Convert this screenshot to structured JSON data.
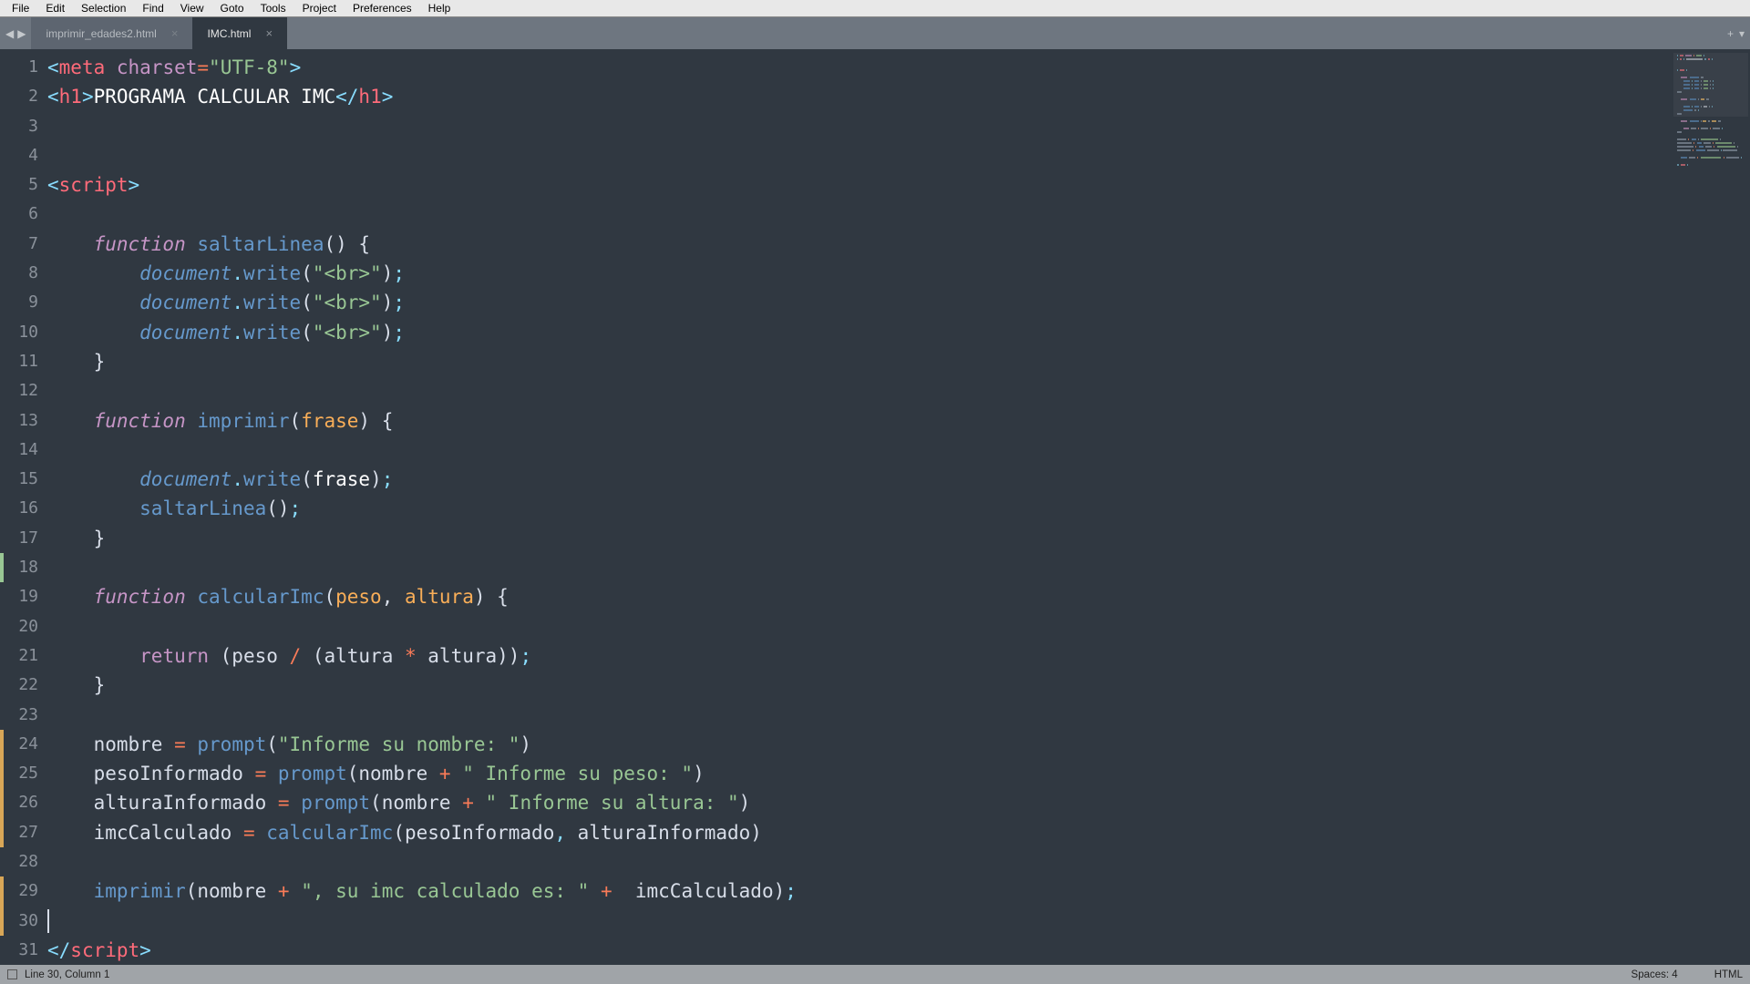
{
  "menu": {
    "items": [
      "File",
      "Edit",
      "Selection",
      "Find",
      "View",
      "Goto",
      "Tools",
      "Project",
      "Preferences",
      "Help"
    ]
  },
  "tabs": {
    "items": [
      {
        "label": "imprimir_edades2.html",
        "active": false
      },
      {
        "label": "IMC.html",
        "active": true
      }
    ]
  },
  "gutter": {
    "count": 31
  },
  "code": {
    "lines": [
      {
        "tokens": [
          {
            "c": "punc",
            "t": "<"
          },
          {
            "c": "tag",
            "t": "meta "
          },
          {
            "c": "attr",
            "t": "charset"
          },
          {
            "c": "op",
            "t": "="
          },
          {
            "c": "str",
            "t": "\"UTF-8\""
          },
          {
            "c": "punc",
            "t": ">"
          }
        ]
      },
      {
        "tokens": [
          {
            "c": "punc",
            "t": "<"
          },
          {
            "c": "tag",
            "t": "h1"
          },
          {
            "c": "punc",
            "t": ">"
          },
          {
            "c": "white",
            "t": "PROGRAMA CALCULAR IMC"
          },
          {
            "c": "punc",
            "t": "</"
          },
          {
            "c": "tag",
            "t": "h1"
          },
          {
            "c": "punc",
            "t": ">"
          }
        ]
      },
      {
        "tokens": []
      },
      {
        "tokens": []
      },
      {
        "tokens": [
          {
            "c": "punc",
            "t": "<"
          },
          {
            "c": "tag",
            "t": "script"
          },
          {
            "c": "punc",
            "t": ">"
          }
        ]
      },
      {
        "tokens": []
      },
      {
        "tokens": [
          {
            "c": "bracket",
            "t": "    "
          },
          {
            "c": "kw",
            "t": "function"
          },
          {
            "c": "bracket",
            "t": " "
          },
          {
            "c": "fn",
            "t": "saltarLinea"
          },
          {
            "c": "bracket",
            "t": "() {"
          }
        ]
      },
      {
        "tokens": [
          {
            "c": "bracket",
            "t": "        "
          },
          {
            "c": "obj",
            "t": "document"
          },
          {
            "c": "punc",
            "t": "."
          },
          {
            "c": "fn",
            "t": "write"
          },
          {
            "c": "bracket",
            "t": "("
          },
          {
            "c": "str",
            "t": "\"<br>\""
          },
          {
            "c": "bracket",
            "t": ")"
          },
          {
            "c": "punc",
            "t": ";"
          }
        ]
      },
      {
        "tokens": [
          {
            "c": "bracket",
            "t": "        "
          },
          {
            "c": "obj",
            "t": "document"
          },
          {
            "c": "punc",
            "t": "."
          },
          {
            "c": "fn",
            "t": "write"
          },
          {
            "c": "bracket",
            "t": "("
          },
          {
            "c": "str",
            "t": "\"<br>\""
          },
          {
            "c": "bracket",
            "t": ")"
          },
          {
            "c": "punc",
            "t": ";"
          }
        ]
      },
      {
        "tokens": [
          {
            "c": "bracket",
            "t": "        "
          },
          {
            "c": "obj",
            "t": "document"
          },
          {
            "c": "punc",
            "t": "."
          },
          {
            "c": "fn",
            "t": "write"
          },
          {
            "c": "bracket",
            "t": "("
          },
          {
            "c": "str",
            "t": "\"<br>\""
          },
          {
            "c": "bracket",
            "t": ")"
          },
          {
            "c": "punc",
            "t": ";"
          }
        ]
      },
      {
        "tokens": [
          {
            "c": "bracket",
            "t": "    }"
          }
        ]
      },
      {
        "tokens": []
      },
      {
        "tokens": [
          {
            "c": "bracket",
            "t": "    "
          },
          {
            "c": "kw",
            "t": "function"
          },
          {
            "c": "bracket",
            "t": " "
          },
          {
            "c": "fn",
            "t": "imprimir"
          },
          {
            "c": "bracket",
            "t": "("
          },
          {
            "c": "param",
            "t": "frase"
          },
          {
            "c": "bracket",
            "t": ") {"
          }
        ]
      },
      {
        "tokens": []
      },
      {
        "tokens": [
          {
            "c": "bracket",
            "t": "        "
          },
          {
            "c": "obj",
            "t": "document"
          },
          {
            "c": "punc",
            "t": "."
          },
          {
            "c": "fn",
            "t": "write"
          },
          {
            "c": "bracket",
            "t": "("
          },
          {
            "c": "white",
            "t": "frase"
          },
          {
            "c": "bracket",
            "t": ")"
          },
          {
            "c": "punc",
            "t": ";"
          }
        ]
      },
      {
        "tokens": [
          {
            "c": "bracket",
            "t": "        "
          },
          {
            "c": "fn",
            "t": "saltarLinea"
          },
          {
            "c": "bracket",
            "t": "()"
          },
          {
            "c": "punc",
            "t": ";"
          }
        ]
      },
      {
        "tokens": [
          {
            "c": "bracket",
            "t": "    }"
          }
        ]
      },
      {
        "tokens": []
      },
      {
        "tokens": [
          {
            "c": "bracket",
            "t": "    "
          },
          {
            "c": "kw",
            "t": "function"
          },
          {
            "c": "bracket",
            "t": " "
          },
          {
            "c": "fn",
            "t": "calcularImc"
          },
          {
            "c": "bracket",
            "t": "("
          },
          {
            "c": "param",
            "t": "peso"
          },
          {
            "c": "bracket",
            "t": ", "
          },
          {
            "c": "param",
            "t": "altura"
          },
          {
            "c": "bracket",
            "t": ") {"
          }
        ]
      },
      {
        "tokens": []
      },
      {
        "tokens": [
          {
            "c": "bracket",
            "t": "        "
          },
          {
            "c": "kw-r",
            "t": "return"
          },
          {
            "c": "bracket",
            "t": " (peso "
          },
          {
            "c": "op",
            "t": "/"
          },
          {
            "c": "bracket",
            "t": " (altura "
          },
          {
            "c": "op",
            "t": "*"
          },
          {
            "c": "bracket",
            "t": " altura))"
          },
          {
            "c": "punc",
            "t": ";"
          }
        ]
      },
      {
        "tokens": [
          {
            "c": "bracket",
            "t": "    }"
          }
        ]
      },
      {
        "tokens": []
      },
      {
        "tokens": [
          {
            "c": "bracket",
            "t": "    nombre "
          },
          {
            "c": "op",
            "t": "="
          },
          {
            "c": "bracket",
            "t": " "
          },
          {
            "c": "fn",
            "t": "prompt"
          },
          {
            "c": "bracket",
            "t": "("
          },
          {
            "c": "str",
            "t": "\"Informe su nombre: \""
          },
          {
            "c": "bracket",
            "t": ")"
          }
        ]
      },
      {
        "tokens": [
          {
            "c": "bracket",
            "t": "    pesoInformado "
          },
          {
            "c": "op",
            "t": "="
          },
          {
            "c": "bracket",
            "t": " "
          },
          {
            "c": "fn",
            "t": "prompt"
          },
          {
            "c": "bracket",
            "t": "(nombre "
          },
          {
            "c": "op",
            "t": "+"
          },
          {
            "c": "bracket",
            "t": " "
          },
          {
            "c": "str",
            "t": "\" Informe su peso: \""
          },
          {
            "c": "bracket",
            "t": ")"
          }
        ]
      },
      {
        "tokens": [
          {
            "c": "bracket",
            "t": "    alturaInformado "
          },
          {
            "c": "op",
            "t": "="
          },
          {
            "c": "bracket",
            "t": " "
          },
          {
            "c": "fn",
            "t": "prompt"
          },
          {
            "c": "bracket",
            "t": "(nombre "
          },
          {
            "c": "op",
            "t": "+"
          },
          {
            "c": "bracket",
            "t": " "
          },
          {
            "c": "str",
            "t": "\" Informe su altura: \""
          },
          {
            "c": "bracket",
            "t": ")"
          }
        ]
      },
      {
        "tokens": [
          {
            "c": "bracket",
            "t": "    imcCalculado "
          },
          {
            "c": "op",
            "t": "="
          },
          {
            "c": "bracket",
            "t": " "
          },
          {
            "c": "fn",
            "t": "calcularImc"
          },
          {
            "c": "bracket",
            "t": "(pesoInformado"
          },
          {
            "c": "punc",
            "t": ","
          },
          {
            "c": "bracket",
            "t": " alturaInformado)"
          }
        ]
      },
      {
        "tokens": []
      },
      {
        "tokens": [
          {
            "c": "bracket",
            "t": "    "
          },
          {
            "c": "fn",
            "t": "imprimir"
          },
          {
            "c": "bracket",
            "t": "(nombre "
          },
          {
            "c": "op",
            "t": "+"
          },
          {
            "c": "bracket",
            "t": " "
          },
          {
            "c": "str",
            "t": "\", su imc calculado es: \""
          },
          {
            "c": "bracket",
            "t": " "
          },
          {
            "c": "op",
            "t": "+"
          },
          {
            "c": "bracket",
            "t": "  imcCalculado)"
          },
          {
            "c": "punc",
            "t": ";"
          }
        ]
      },
      {
        "tokens": []
      },
      {
        "tokens": [
          {
            "c": "punc",
            "t": "</"
          },
          {
            "c": "tag",
            "t": "script"
          },
          {
            "c": "punc",
            "t": ">"
          }
        ]
      }
    ]
  },
  "modified_ranges": {
    "orange": [
      [
        24,
        27
      ],
      [
        29,
        30
      ]
    ],
    "green": [
      [
        18,
        18
      ]
    ]
  },
  "cursor": {
    "line": 30,
    "col": 1
  },
  "status": {
    "left": "Line 30, Column 1",
    "spaces": "Spaces: 4",
    "syntax": "HTML"
  }
}
